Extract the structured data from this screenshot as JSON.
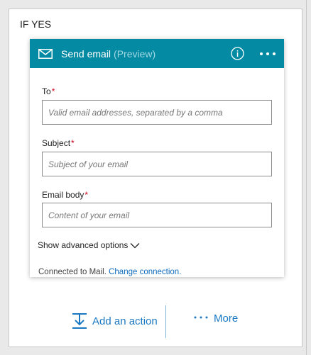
{
  "branch": {
    "title": "IF YES"
  },
  "card": {
    "title": "Send email",
    "preview_tag": "(Preview)",
    "header_color": "#058aa4",
    "fields": [
      {
        "label": "To",
        "required_mark": "*",
        "placeholder": "Valid email addresses, separated by a comma",
        "value": ""
      },
      {
        "label": "Subject",
        "required_mark": "*",
        "placeholder": "Subject of your email",
        "value": ""
      },
      {
        "label": "Email body",
        "required_mark": "*",
        "placeholder": "Content of your email",
        "value": ""
      }
    ],
    "advanced_label": "Show advanced options",
    "connection": {
      "text": "Connected to Mail.",
      "link": "Change connection."
    }
  },
  "actions": {
    "add_label": "Add an action",
    "more_label": "More"
  },
  "icons": {
    "mail": "mail-icon",
    "info": "info-icon",
    "menu": "more-horizontal-icon",
    "chevron": "chevron-down-icon",
    "add_action": "add-step-icon",
    "more": "ellipsis-icon"
  }
}
